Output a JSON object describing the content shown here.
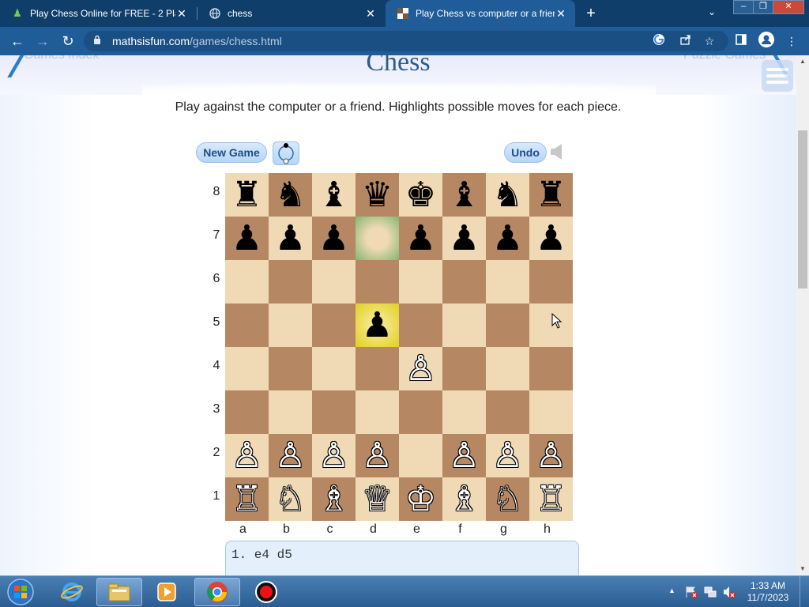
{
  "browser": {
    "tabs": [
      {
        "title": "Play Chess Online for FREE - 2 Pla",
        "icon": "chess-pawn-icon",
        "close": "✕"
      },
      {
        "title": "chess",
        "icon": "globe-icon",
        "close": "✕"
      },
      {
        "title": "Play Chess vs computer or a frien",
        "icon": "chess-board-icon",
        "close": "✕"
      }
    ],
    "new_tab": "+",
    "tab_list": "⌄",
    "window_controls": {
      "minimize": "–",
      "restore": "❐",
      "close": "✕"
    },
    "url_host": "mathsisfun.com",
    "url_path": "/games/chess.html",
    "back": "←",
    "forward": "→",
    "reload": "↻"
  },
  "page": {
    "title": "Chess",
    "nav_left": "Games Index",
    "nav_right": "Puzzle Games",
    "subtitle": "Play against the computer or a friend. Highlights possible moves for each piece.",
    "new_game_label": "New Game",
    "undo_label": "Undo",
    "ranks": [
      "8",
      "7",
      "6",
      "5",
      "4",
      "3",
      "2",
      "1"
    ],
    "files": [
      "a",
      "b",
      "c",
      "d",
      "e",
      "f",
      "g",
      "h"
    ],
    "board": [
      [
        "♜",
        "♞",
        "♝",
        "♛",
        "♚",
        "♝",
        "♞",
        "♜"
      ],
      [
        "♟",
        "♟",
        "♟",
        "",
        "♟",
        "♟",
        "♟",
        "♟"
      ],
      [
        "",
        "",
        "",
        "",
        "",
        "",
        "",
        ""
      ],
      [
        "",
        "",
        "",
        "♟",
        "",
        "",
        "",
        ""
      ],
      [
        "",
        "",
        "",
        "",
        "♙",
        "",
        "",
        ""
      ],
      [
        "",
        "",
        "",
        "",
        "",
        "",
        "",
        ""
      ],
      [
        "♙",
        "♙",
        "♙",
        "♙",
        "",
        "♙",
        "♙",
        "♙"
      ],
      [
        "♖",
        "♘",
        "♗",
        "♕",
        "♔",
        "♗",
        "♘",
        "♖"
      ]
    ],
    "board_colors": [
      [
        "b",
        "b",
        "b",
        "b",
        "b",
        "b",
        "b",
        "b"
      ],
      [
        "b",
        "b",
        "b",
        "",
        "b",
        "b",
        "b",
        "b"
      ],
      [
        "",
        "",
        "",
        "",
        "",
        "",
        "",
        ""
      ],
      [
        "",
        "",
        "",
        "b",
        "",
        "",
        "",
        ""
      ],
      [
        "",
        "",
        "",
        "",
        "w",
        "",
        "",
        ""
      ],
      [
        "",
        "",
        "",
        "",
        "",
        "",
        "",
        ""
      ],
      [
        "w",
        "w",
        "w",
        "w",
        "",
        "w",
        "w",
        "w"
      ],
      [
        "w",
        "w",
        "w",
        "w",
        "w",
        "w",
        "w",
        "w"
      ]
    ],
    "highlights": {
      "from": "d7",
      "to": "d5"
    },
    "move_list": "1. e4 d5"
  },
  "taskbar": {
    "apps": [
      "explorer-ie-icon",
      "file-explorer-icon",
      "media-player-icon",
      "chrome-icon",
      "recorder-icon"
    ],
    "time": "1:33 AM",
    "date": "11/7/2023",
    "tray_arrow": "▲"
  },
  "colors": {
    "tabstrip": "#0f3e6b",
    "toolbar": "#1f5c98",
    "board_light": "#f0d9b5",
    "board_dark": "#b58863",
    "highlight_to": "#e2cf22",
    "highlight_from": "#7fb870"
  }
}
